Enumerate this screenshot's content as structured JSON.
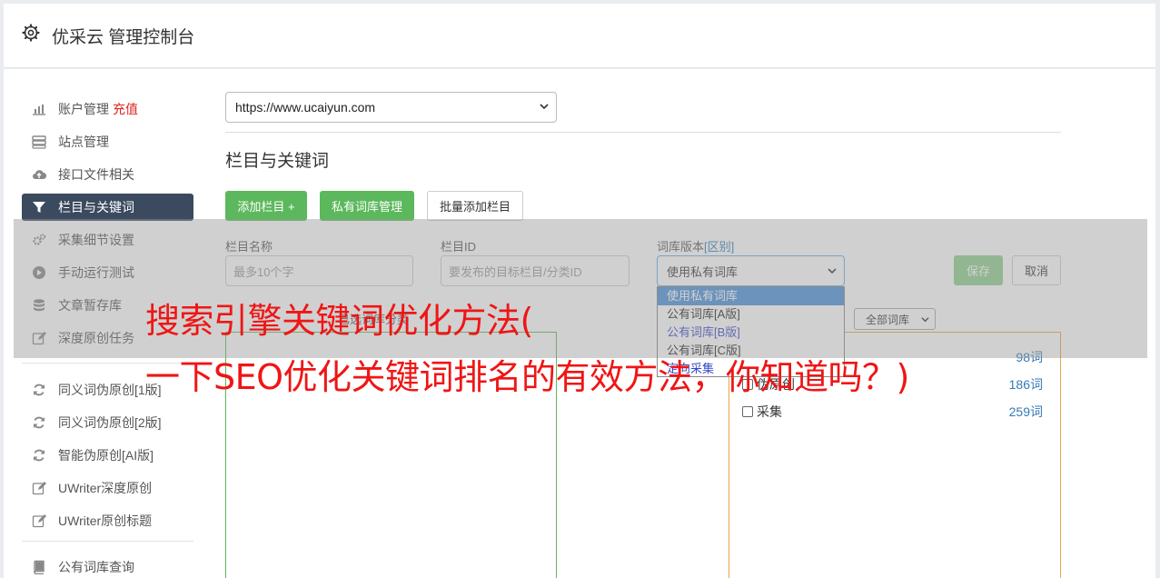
{
  "header": {
    "title": "优采云 管理控制台"
  },
  "sidebar": {
    "items": [
      {
        "label": "账户管理",
        "badge": "充值",
        "icon": "bar-chart-icon"
      },
      {
        "label": "站点管理",
        "icon": "server-icon"
      },
      {
        "label": "接口文件相关",
        "icon": "cloud-upload-icon"
      },
      {
        "label": "栏目与关键词",
        "icon": "filter-icon",
        "active": true
      },
      {
        "label": "采集细节设置",
        "icon": "cogs-icon"
      },
      {
        "label": "手动运行测试",
        "icon": "play-circle-icon"
      },
      {
        "label": "文章暂存库",
        "icon": "database-icon"
      },
      {
        "label": "深度原创任务",
        "icon": "edit-icon"
      },
      {
        "label": "同义词伪原创[1版]",
        "icon": "refresh-icon"
      },
      {
        "label": "同义词伪原创[2版]",
        "icon": "refresh-icon"
      },
      {
        "label": "智能伪原创[AI版]",
        "icon": "refresh-icon"
      },
      {
        "label": "UWriter深度原创",
        "icon": "edit-icon"
      },
      {
        "label": "UWriter原创标题",
        "icon": "edit-icon"
      },
      {
        "label": "公有词库查询",
        "icon": "book-icon"
      }
    ]
  },
  "content": {
    "site_select_value": "https://www.ucaiyun.com",
    "section_title": "栏目与关键词",
    "buttons": {
      "add_column": "添加栏目 +",
      "private_lib": "私有词库管理",
      "batch_add": "批量添加栏目"
    },
    "form": {
      "name_label": "栏目名称",
      "name_placeholder": "最多10个字",
      "id_label": "栏目ID",
      "id_placeholder": "要发布的目标栏目/分类ID",
      "lib_label": "词库版本",
      "lib_link": "[区别]",
      "lib_value": "使用私有词库",
      "save": "保存",
      "cancel": "取消"
    },
    "dropdown_options": [
      "使用私有词库",
      "公有词库[A版]",
      "公有词库[B版]",
      "公有词库[C版]",
      "定向采集"
    ],
    "columns_label": "已选词库分类",
    "lib_filter_value": "全部词库",
    "categories": [
      {
        "label": "",
        "count": "98词"
      },
      {
        "label": "伪原创",
        "count": "186词"
      },
      {
        "label": "采集",
        "count": "259词"
      }
    ]
  },
  "overlay": {
    "line1": "搜索引擎关键词优化方法(",
    "line2": "一下SEO优化关键词排名的有效方法，你知道吗？)"
  },
  "colors": {
    "active_nav": "#3b4a5f",
    "green": "#5cb85c",
    "overlay_text": "#f01515",
    "recharge": "#e1251b"
  }
}
